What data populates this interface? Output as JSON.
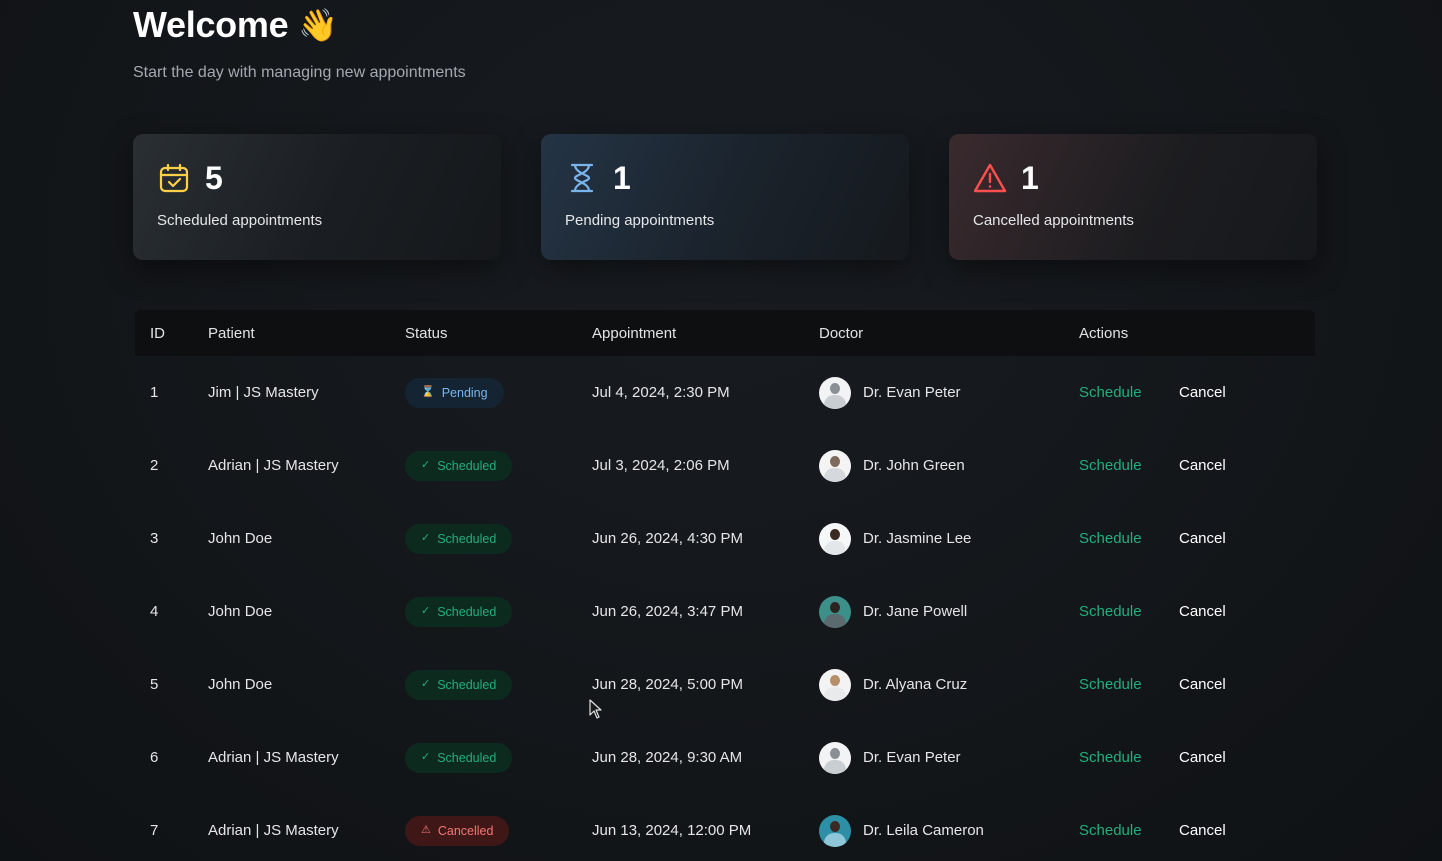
{
  "header": {
    "title": "Welcome",
    "wave_emoji": "👋",
    "subtitle": "Start the day with managing new appointments"
  },
  "stats": [
    {
      "count": "5",
      "label": "Scheduled appointments",
      "icon": "calendar-check-icon",
      "color": "#ffd147"
    },
    {
      "count": "1",
      "label": "Pending appointments",
      "icon": "hourglass-icon",
      "color": "#79b5ec"
    },
    {
      "count": "1",
      "label": "Cancelled appointments",
      "icon": "warning-triangle-icon",
      "color": "#ff4f4e"
    }
  ],
  "table": {
    "columns": [
      "ID",
      "Patient",
      "Status",
      "Appointment",
      "Doctor",
      "Actions"
    ],
    "schedule_label": "Schedule",
    "cancel_label": "Cancel",
    "rows": [
      {
        "id": "1",
        "patient": "Jim | JS Mastery",
        "status": "Pending",
        "status_type": "pending",
        "appointment": "Jul 4, 2024, 2:30 PM",
        "doctor": "Dr. Evan Peter"
      },
      {
        "id": "2",
        "patient": "Adrian | JS Mastery",
        "status": "Scheduled",
        "status_type": "scheduled",
        "appointment": "Jul 3, 2024, 2:06 PM",
        "doctor": "Dr. John Green"
      },
      {
        "id": "3",
        "patient": "John Doe",
        "status": "Scheduled",
        "status_type": "scheduled",
        "appointment": "Jun 26, 2024, 4:30 PM",
        "doctor": "Dr. Jasmine Lee"
      },
      {
        "id": "4",
        "patient": "John Doe",
        "status": "Scheduled",
        "status_type": "scheduled",
        "appointment": "Jun 26, 2024, 3:47 PM",
        "doctor": "Dr. Jane Powell"
      },
      {
        "id": "5",
        "patient": "John Doe",
        "status": "Scheduled",
        "status_type": "scheduled",
        "appointment": "Jun 28, 2024, 5:00 PM",
        "doctor": "Dr. Alyana Cruz"
      },
      {
        "id": "6",
        "patient": "Adrian | JS Mastery",
        "status": "Scheduled",
        "status_type": "scheduled",
        "appointment": "Jun 28, 2024, 9:30 AM",
        "doctor": "Dr. Evan Peter"
      },
      {
        "id": "7",
        "patient": "Adrian | JS Mastery",
        "status": "Cancelled",
        "status_type": "cancelled",
        "appointment": "Jun 13, 2024, 12:00 PM",
        "doctor": "Dr. Leila Cameron"
      }
    ]
  },
  "colors": {
    "accent_green": "#24ae7c",
    "pending_blue": "#79b5ec",
    "cancelled_red": "#f37877",
    "background": "#131619"
  }
}
